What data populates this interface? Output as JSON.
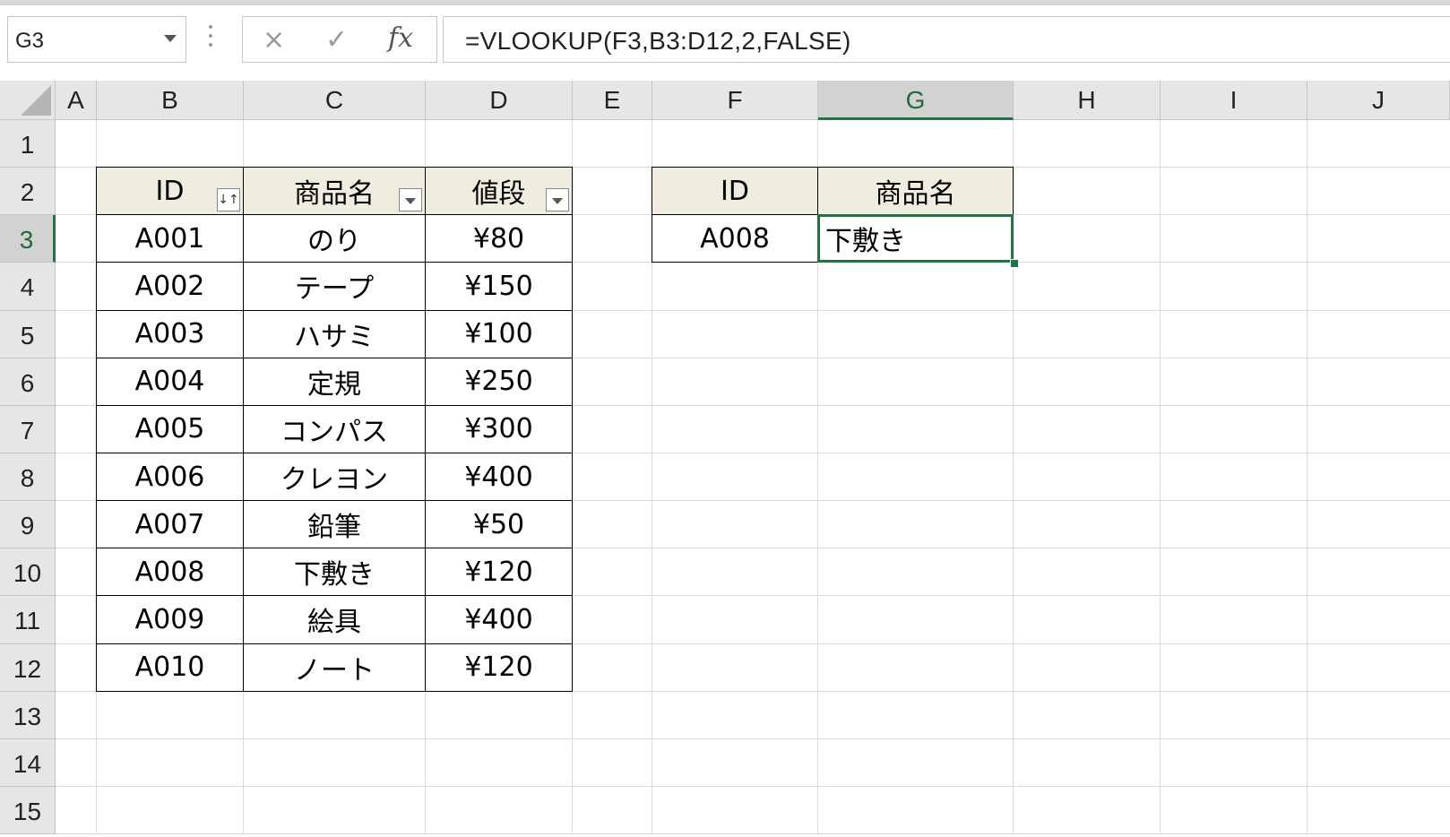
{
  "formula_bar": {
    "name_box": "G3",
    "cancel_icon": "×",
    "enter_icon": "✓",
    "fx_label": "fx",
    "formula": "=VLOOKUP(F3,B3:D12,2,FALSE)"
  },
  "columns": [
    "A",
    "B",
    "C",
    "D",
    "E",
    "F",
    "G",
    "H",
    "I",
    "J"
  ],
  "selected_column": "G",
  "rows": [
    "1",
    "2",
    "3",
    "4",
    "5",
    "6",
    "7",
    "8",
    "9",
    "10",
    "11",
    "12",
    "13",
    "14",
    "15"
  ],
  "selected_row": "3",
  "table": {
    "headers": [
      "ID",
      "商品名",
      "値段"
    ],
    "rows": [
      [
        "A001",
        "のり",
        "¥80"
      ],
      [
        "A002",
        "テープ",
        "¥150"
      ],
      [
        "A003",
        "ハサミ",
        "¥100"
      ],
      [
        "A004",
        "定規",
        "¥250"
      ],
      [
        "A005",
        "コンパス",
        "¥300"
      ],
      [
        "A006",
        "クレヨン",
        "¥400"
      ],
      [
        "A007",
        "鉛筆",
        "¥50"
      ],
      [
        "A008",
        "下敷き",
        "¥120"
      ],
      [
        "A009",
        "絵具",
        "¥400"
      ],
      [
        "A010",
        "ノート",
        "¥120"
      ]
    ]
  },
  "lookup": {
    "headers": [
      "ID",
      "商品名"
    ],
    "id": "A008",
    "result": "下敷き"
  },
  "colors": {
    "accent": "#217346",
    "header_fill": "#f0ece0"
  }
}
